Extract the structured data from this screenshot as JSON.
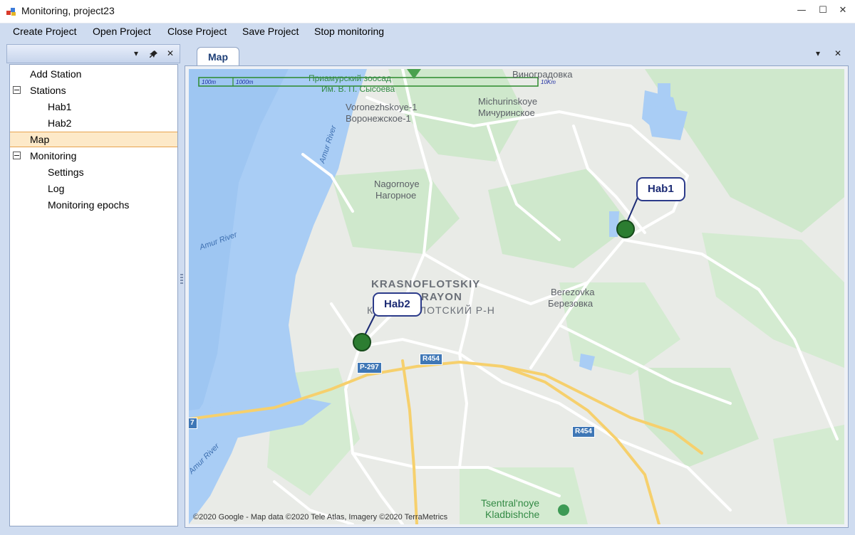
{
  "window": {
    "title": "Monitoring, project23",
    "minimize_glyph": "—",
    "maximize_glyph": "☐",
    "close_glyph": "✕"
  },
  "menu": {
    "items": [
      "Create Project",
      "Open Project",
      "Close Project",
      "Save Project",
      "Stop monitoring"
    ]
  },
  "left_panel": {
    "dropdown_glyph": "▾",
    "pin_glyph": "📌",
    "close_glyph": "✕",
    "tree": [
      {
        "label": "Add Station",
        "level": 0,
        "expander": false
      },
      {
        "label": "Stations",
        "level": 0,
        "expander": true
      },
      {
        "label": "Hab1",
        "level": 1,
        "expander": false
      },
      {
        "label": "Hab2",
        "level": 1,
        "expander": false
      },
      {
        "label": "Map",
        "level": 0,
        "expander": false,
        "selected": true
      },
      {
        "label": "Monitoring",
        "level": 0,
        "expander": true
      },
      {
        "label": "Settings",
        "level": 1,
        "expander": false
      },
      {
        "label": "Log",
        "level": 1,
        "expander": false
      },
      {
        "label": "Monitoring epochs",
        "level": 1,
        "expander": false
      }
    ]
  },
  "doc": {
    "tab_label": "Map",
    "dropdown_glyph": "▾",
    "close_glyph": "✕"
  },
  "map": {
    "scale": {
      "a": "100m",
      "b": "1000m",
      "c": "10Km"
    },
    "places": {
      "zoo_ru1": "Приамурский зоосад",
      "zoo_ru2": "Им. В. П. Сысоева",
      "vinogradovka": "Виноградовка",
      "voronezh_en": "Voronezhskoye-1",
      "voronezh_ru": "Воронежское-1",
      "michurin_en": "Michurinskoye",
      "michurin_ru": "Мичуринское",
      "nagornoye_en": "Nagornoye",
      "nagornoye_ru": "Нагорное",
      "district_en1": "KRASNOFLOTSKIY",
      "district_en2": "RAYON",
      "district_ru": "КРАСНОФЛОТСКИЙ Р-Н",
      "berezovka_en": "Berezovka",
      "berezovka_ru": "Березовка",
      "tsentral_en": "Tsentral'noye",
      "tsentral_ru": "Kladbishche"
    },
    "rivers": {
      "amur1": "Amur River",
      "amur2": "Amur River",
      "amur3": "Amur River"
    },
    "roads": {
      "p297": "P-297",
      "r454a": "R454",
      "r454b": "R454",
      "edge7": "7"
    },
    "stations": [
      {
        "name": "Hab1",
        "color": "#2c7d31"
      },
      {
        "name": "Hab2",
        "color": "#2c7d31"
      }
    ],
    "attribution": "©2020 Google - Map data ©2020 Tele Atlas, Imagery ©2020 TerraMetrics"
  }
}
